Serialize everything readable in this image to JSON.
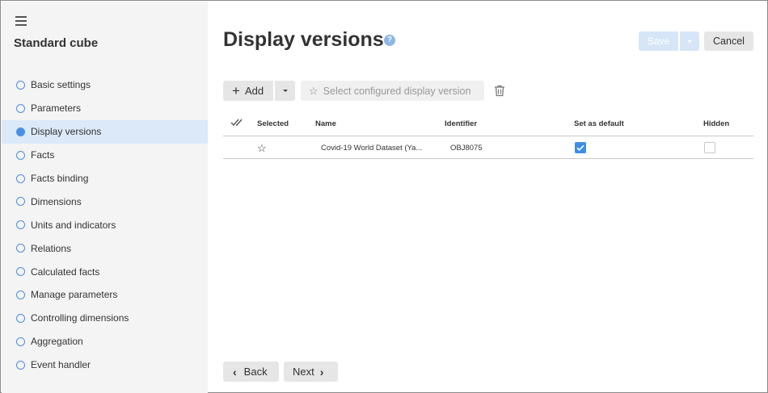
{
  "sidebar": {
    "title": "Standard cube",
    "items": [
      {
        "label": "Basic settings"
      },
      {
        "label": "Parameters"
      },
      {
        "label": "Display versions",
        "active": true
      },
      {
        "label": "Facts"
      },
      {
        "label": "Facts binding"
      },
      {
        "label": "Dimensions"
      },
      {
        "label": "Units and indicators"
      },
      {
        "label": "Relations"
      },
      {
        "label": "Calculated facts"
      },
      {
        "label": "Manage parameters"
      },
      {
        "label": "Controlling dimensions"
      },
      {
        "label": "Aggregation"
      },
      {
        "label": "Event handler"
      }
    ]
  },
  "header": {
    "title": "Display versions",
    "help_icon": "?",
    "save_label": "Save",
    "cancel_label": "Cancel"
  },
  "toolbar": {
    "add_label": "Add",
    "select_label": "Select configured display version"
  },
  "table": {
    "columns": {
      "selected": "Selected",
      "name": "Name",
      "identifier": "Identifier",
      "set_default": "Set as default",
      "hidden": "Hidden"
    },
    "rows": [
      {
        "name": "Covid-19 World Dataset (Ya...",
        "identifier": "OBJ8075",
        "set_default": true,
        "hidden": false
      }
    ]
  },
  "footer": {
    "back_label": "Back",
    "next_label": "Next"
  },
  "colors": {
    "accent": "#4a90e2",
    "active_item_bg": "#dbe9f9",
    "checkbox_checked": "#3d8ee6"
  }
}
